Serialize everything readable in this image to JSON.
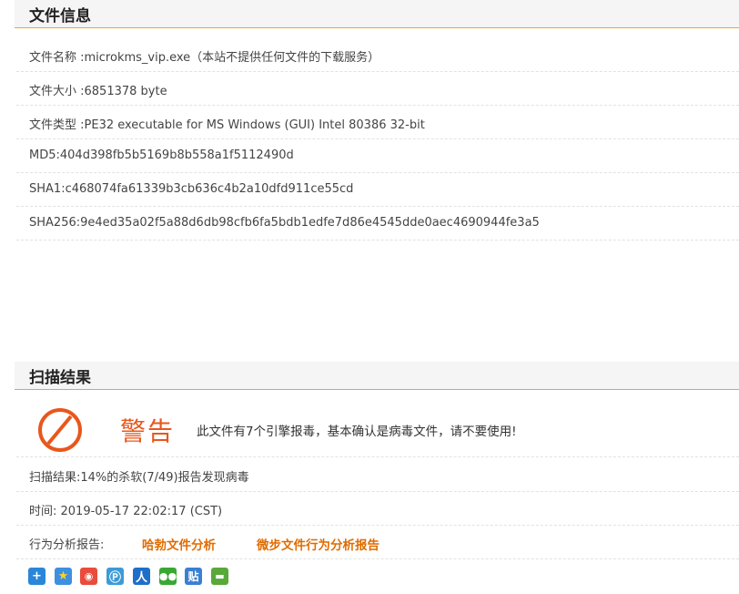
{
  "file_info": {
    "title": "文件信息",
    "rows": [
      "文件名称 :microkms_vip.exe（本站不提供任何文件的下载服务）",
      "文件大小 :6851378 byte",
      "文件类型 :PE32 executable for MS Windows (GUI) Intel 80386 32-bit",
      "MD5:404d398fb5b5169b8b558a1f5112490d",
      "SHA1:c468074fa61339b3cb636c4b2a10dfd911ce55cd",
      "SHA256:9e4ed35a02f5a88d6db98cfb6fa5bdb1edfe7d86e4545dde0aec4690944fe3a5"
    ]
  },
  "scan_result": {
    "title": "扫描结果",
    "warning_word": "警告",
    "warning_message": "此文件有7个引擎报毒，基本确认是病毒文件，请不要使用!",
    "summary": "扫描结果:14%的杀软(7/49)报告发现病毒",
    "time": "时间: 2019-05-17 22:02:17 (CST)",
    "behavior_label": "行为分析报告:",
    "behavior_links": [
      "哈勃文件分析",
      "微步文件行为分析报告"
    ]
  },
  "share_icons": [
    "add-share-icon",
    "qzone-icon",
    "weibo-icon",
    "tencent-weibo-icon",
    "renren-icon",
    "wechat-icon",
    "tieba-icon",
    "douban-icon"
  ],
  "colors": {
    "accent_line": "#e8a633",
    "warning": "#e8571c",
    "link": "#e06c00"
  }
}
